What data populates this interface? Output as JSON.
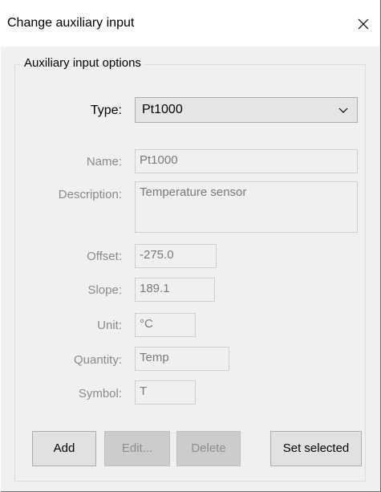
{
  "window": {
    "title": "Change auxiliary input",
    "close_icon": "close-icon"
  },
  "group": {
    "legend": "Auxiliary input options"
  },
  "form": {
    "type_label": "Type:",
    "type_value": "Pt1000",
    "name_label": "Name:",
    "name_value": "Pt1000",
    "description_label": "Description:",
    "description_value": "Temperature sensor",
    "offset_label": "Offset:",
    "offset_value": "-275.0",
    "slope_label": "Slope:",
    "slope_value": "189.1",
    "unit_label": "Unit:",
    "unit_value": "°C",
    "quantity_label": "Quantity:",
    "quantity_value": "Temp",
    "symbol_label": "Symbol:",
    "symbol_value": "T"
  },
  "buttons": {
    "add": "Add",
    "edit": "Edit...",
    "delete": "Delete",
    "set_selected": "Set selected"
  },
  "colors": {
    "dialog_bg": "#f0f0f0",
    "title_bg": "#ffffff",
    "disabled_text": "#8a8a8a",
    "disabled_button_bg": "#cccccc",
    "button_bg": "#e1e1e1"
  }
}
